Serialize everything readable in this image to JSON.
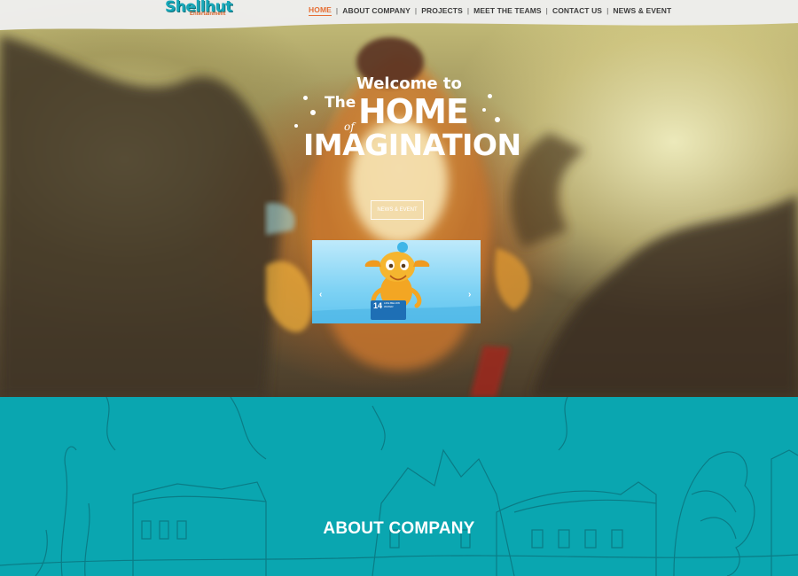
{
  "logo": {
    "name": "Shellhut",
    "tagline": "Entertainment"
  },
  "nav": {
    "items": [
      {
        "label": "HOME",
        "active": true
      },
      {
        "label": "ABOUT COMPANY",
        "active": false
      },
      {
        "label": "PROJECTS",
        "active": false
      },
      {
        "label": "MEET THE TEAMS",
        "active": false
      },
      {
        "label": "CONTACT US",
        "active": false
      },
      {
        "label": "NEWS & EVENT",
        "active": false
      }
    ]
  },
  "hero": {
    "line1": "Welcome to",
    "line2_small": "The",
    "line2_big": "HOME",
    "line3_small": "of",
    "line3_big": "IMAGINATION",
    "button_label": "NEWS & EVENT"
  },
  "slider": {
    "prev_icon": "chevron-left-icon",
    "next_icon": "chevron-right-icon",
    "badge_number": "14",
    "badge_text": "LIFE BELOW WATER"
  },
  "about": {
    "title": "ABOUT COMPANY"
  },
  "colors": {
    "brand_teal": "#0aa6b0",
    "nav_active": "#e66e34",
    "logo_teal": "#17a7b8"
  }
}
